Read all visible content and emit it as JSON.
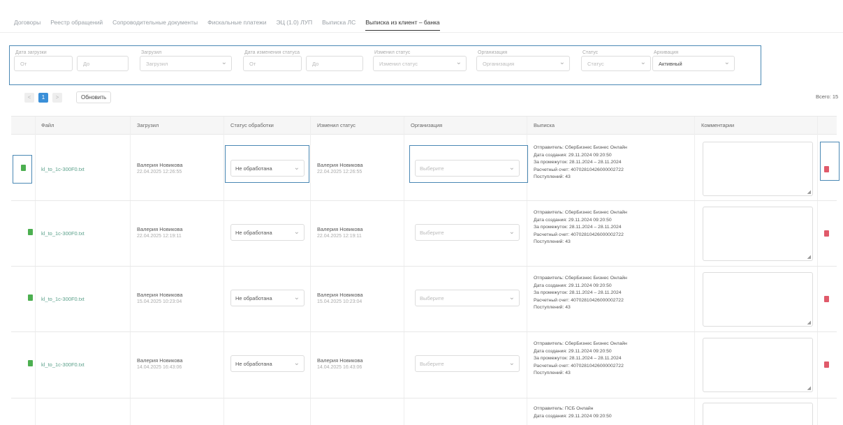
{
  "tabs": [
    {
      "label": "Договоры",
      "active": false
    },
    {
      "label": "Реестр обращений",
      "active": false
    },
    {
      "label": "Сопроводительные документы",
      "active": false
    },
    {
      "label": "Фискальные платежи",
      "active": false
    },
    {
      "label": "ЭЦ (1.0) ЛУП",
      "active": false
    },
    {
      "label": "Выписка ЛС",
      "active": false
    },
    {
      "label": "Выписка из клиент – банка",
      "active": true
    }
  ],
  "filters": {
    "date_loaded": {
      "label": "Дата загрузки",
      "from": "От",
      "to": "До"
    },
    "loaded_by": {
      "label": "Загрузил",
      "placeholder": "Загрузил"
    },
    "date_status": {
      "label": "Дата изменения статуса",
      "from": "От",
      "to": "До"
    },
    "status_changed_by": {
      "label": "Изменил статус",
      "placeholder": "Изменил статус"
    },
    "organization": {
      "label": "Организация",
      "placeholder": "Организация"
    },
    "status": {
      "label": "Статус",
      "placeholder": "Статус"
    },
    "archive": {
      "label": "Архивация",
      "value": "Активный"
    }
  },
  "pager": {
    "prev": "<",
    "current": "1",
    "next": ">",
    "refresh": "Обновить"
  },
  "total": "Всего: 15",
  "columns": [
    "Файл",
    "Загрузил",
    "Статус обработки",
    "Изменил статус",
    "Организация",
    "Выписка",
    "Комментарии"
  ],
  "rows": [
    {
      "file": "kl_to_1c-300F0.txt",
      "loaded_by": "Валерия Новикова",
      "loaded_date": "22.04.2025 12:26:55",
      "status": "Не обработана",
      "changed_by": "Валерия Новикова",
      "changed_date": "22.04.2025 12:26:55",
      "organization": "Выберите",
      "statement": [
        "Отправитель: СберБизнес Бизнес Онлайн",
        "Дата создания: 29.11.2024 09:20:50",
        "За промежуток: 28.11.2024 – 28.11.2024",
        "Расчетный счет: 40702810426000002722",
        "Поступлений: 43"
      ]
    },
    {
      "file": "kl_to_1c-300F0.txt",
      "loaded_by": "Валерия Новикова",
      "loaded_date": "22.04.2025 12:19:11",
      "status": "Не обработана",
      "changed_by": "Валерия Новикова",
      "changed_date": "22.04.2025 12:19:11",
      "organization": "Выберите",
      "statement": [
        "Отправитель: СберБизнес Бизнес Онлайн",
        "Дата создания: 29.11.2024 09:20:50",
        "За промежуток: 28.11.2024 – 28.11.2024",
        "Расчетный счет: 40702810426000002722",
        "Поступлений: 43"
      ]
    },
    {
      "file": "kl_to_1c-300F0.txt",
      "loaded_by": "Валерия Новикова",
      "loaded_date": "15.04.2025 10:23:04",
      "status": "Не обработана",
      "changed_by": "Валерия Новикова",
      "changed_date": "15.04.2025 10:23:04",
      "organization": "Выберите",
      "statement": [
        "Отправитель: СберБизнес Бизнес Онлайн",
        "Дата создания: 29.11.2024 09:20:50",
        "За промежуток: 28.11.2024 – 28.11.2024",
        "Расчетный счет: 40702810426000002722",
        "Поступлений: 43"
      ]
    },
    {
      "file": "kl_to_1c-300F0.txt",
      "loaded_by": "Валерия Новикова",
      "loaded_date": "14.04.2025 16:43:06",
      "status": "Не обработана",
      "changed_by": "Валерия Новикова",
      "changed_date": "14.04.2025 16:43:06",
      "organization": "Выберите",
      "statement": [
        "Отправитель: СберБизнес Бизнес Онлайн",
        "Дата создания: 29.11.2024 09:20:50",
        "За промежуток: 28.11.2024 – 28.11.2024",
        "Расчетный счет: 40702810426000002722",
        "Поступлений: 43"
      ]
    },
    {
      "statement": [
        "Отправитель: ПСБ Онлайн",
        "Дата создания: 29.11.2024 09:20:50"
      ]
    }
  ]
}
